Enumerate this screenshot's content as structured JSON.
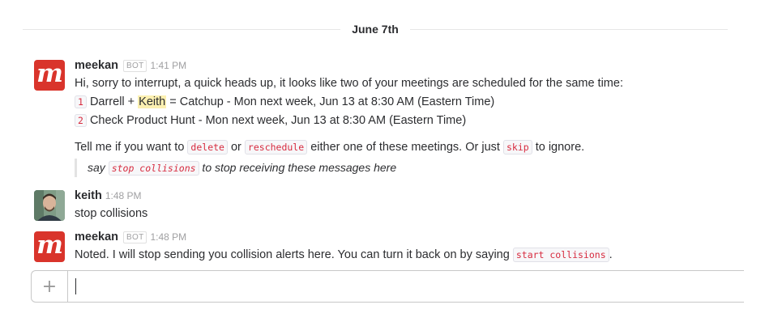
{
  "date_divider": "June 7th",
  "messages": [
    {
      "sender": "meekan",
      "badge": "BOT",
      "time": "1:41 PM",
      "avatar_letter": "m",
      "intro": "Hi, sorry to interrupt, a quick heads up, it looks like two of your meetings are scheduled for the same time:",
      "conflicts": [
        {
          "num": "1",
          "pre": "Darrell + ",
          "highlight": "Keith",
          "post": " = Catchup - Mon next week, Jun 13 at 8:30 AM (Eastern Time)"
        },
        {
          "num": "2",
          "text": "Check Product Hunt - Mon next week, Jun 13 at 8:30 AM (Eastern Time)"
        }
      ],
      "prompt": {
        "p1": "Tell me if you want to ",
        "cmd_delete": "delete",
        "p2": " or ",
        "cmd_reschedule": "reschedule",
        "p3": " either one of these meetings. Or just ",
        "cmd_skip": "skip",
        "p4": " to ignore."
      },
      "quote": {
        "pre": "say ",
        "cmd": "stop collisions",
        "post": " to stop receiving these messages here"
      }
    },
    {
      "sender": "keith",
      "time": "1:48 PM",
      "text": "stop collisions"
    },
    {
      "sender": "meekan",
      "badge": "BOT",
      "time": "1:48 PM",
      "avatar_letter": "m",
      "text_pre": "Noted. I will stop sending you collision alerts here. You can turn it back on by saying ",
      "cmd": "start collisions",
      "text_post": "."
    }
  ],
  "composer": {
    "plus_glyph": "+",
    "value": ""
  },
  "icons": {
    "attach": "plus-icon",
    "meekan_avatar": "meekan-logo-icon",
    "keith_avatar": "user-avatar"
  },
  "colors": {
    "meekan_red": "#d9342b",
    "code_text": "#d72b3f",
    "highlight": "#fcf0b1"
  }
}
